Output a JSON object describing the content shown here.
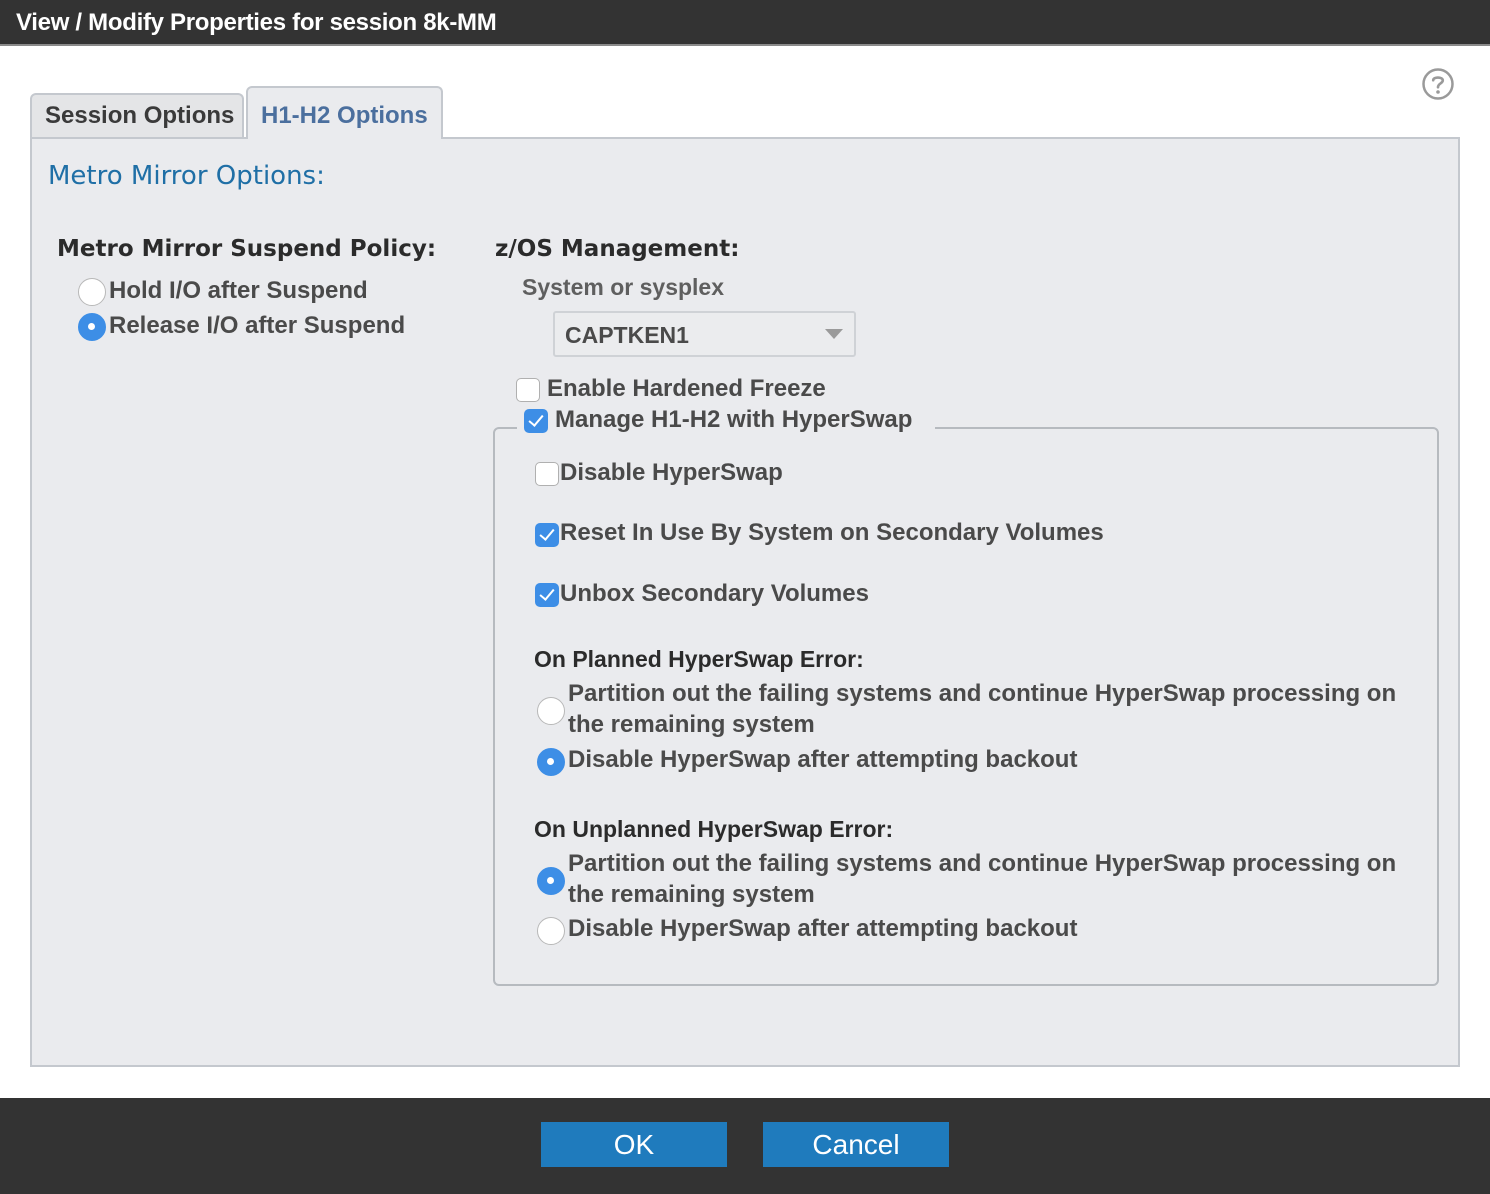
{
  "window": {
    "title": "View / Modify Properties for session 8k-MM"
  },
  "tabs": [
    {
      "label": "Session Options",
      "selected": false
    },
    {
      "label": "H1-H2 Options",
      "selected": true
    }
  ],
  "panel": {
    "section_title": "Metro Mirror Options:",
    "suspend_policy": {
      "heading": "Metro Mirror Suspend Policy:",
      "options": [
        {
          "label": "Hold I/O after Suspend",
          "selected": false
        },
        {
          "label": "Release I/O after Suspend",
          "selected": true
        }
      ]
    },
    "zos": {
      "heading": "z/OS Management:",
      "system_label": "System or sysplex",
      "system_value": "CAPTKEN1",
      "enable_hardened_freeze": {
        "label": "Enable Hardened Freeze",
        "checked": false
      },
      "manage_hyperswap": {
        "label": "Manage H1-H2 with HyperSwap",
        "checked": true
      }
    },
    "hyperswap": {
      "disable_hyperswap": {
        "label": "Disable HyperSwap",
        "checked": false
      },
      "reset_in_use": {
        "label": "Reset In Use By System on Secondary Volumes",
        "checked": true
      },
      "unbox_secondary": {
        "label": "Unbox Secondary Volumes",
        "checked": true
      },
      "planned_error": {
        "heading": "On Planned HyperSwap Error:",
        "options": [
          {
            "line1": "Partition out the failing systems and continue HyperSwap processing on",
            "line2": "the remaining system",
            "selected": false
          },
          {
            "label": "Disable HyperSwap after attempting backout",
            "selected": true
          }
        ]
      },
      "unplanned_error": {
        "heading": "On Unplanned HyperSwap Error:",
        "options": [
          {
            "line1": "Partition out the failing systems and continue HyperSwap processing on",
            "line2": "the remaining system",
            "selected": true
          },
          {
            "label": "Disable HyperSwap after attempting backout",
            "selected": false
          }
        ]
      }
    }
  },
  "footer": {
    "ok_label": "OK",
    "cancel_label": "Cancel"
  },
  "colors": {
    "accent": "#3d8ee6",
    "button": "#1f7bbd",
    "title_bar": "#333333",
    "section_title": "#1f6fa6",
    "tab_selected_text": "#4b6f9e"
  },
  "icons": {
    "help": "help-question-icon",
    "dropdown": "chevron-down-icon"
  }
}
